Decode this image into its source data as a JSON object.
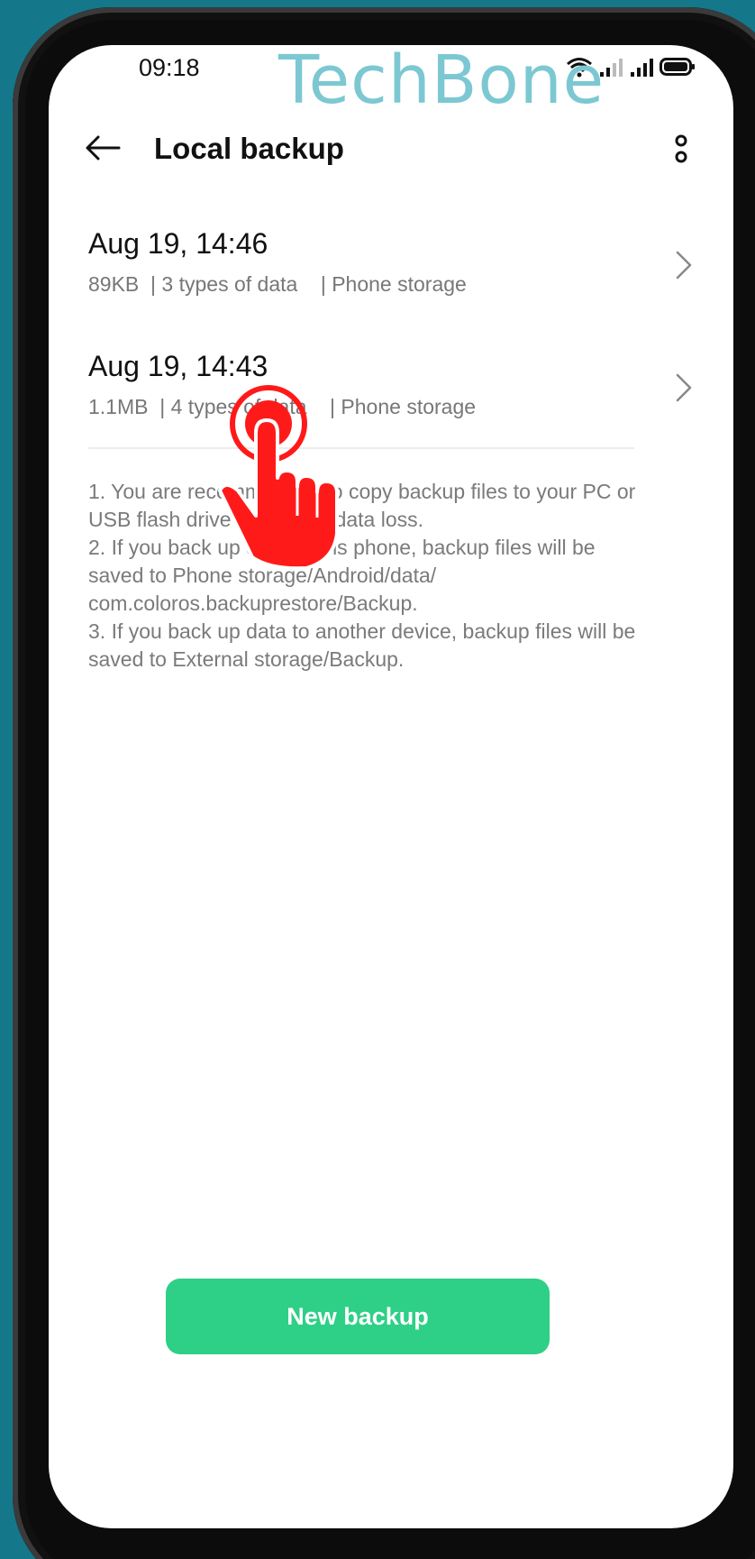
{
  "status_bar": {
    "time": "09:18",
    "icons": [
      "wifi-icon",
      "signal-icon",
      "signal-icon",
      "battery-icon"
    ]
  },
  "watermark": "TechBone",
  "header": {
    "title": "Local backup",
    "back_icon": "arrow-left-icon",
    "more_icon": "more-vertical-icon"
  },
  "backups": [
    {
      "date": "Aug 19, 14:46",
      "meta": "89KB  | 3 types of data    | Phone storage"
    },
    {
      "date": "Aug 19, 14:43",
      "meta": "1.1MB  | 4 types of data    | Phone storage"
    }
  ],
  "notes": [
    "1. You are recommended to copy backup files to your PC or USB flash drive to prevent data loss.",
    "2. If you back up data to this phone, backup files will be saved to Phone storage/Android/data/ com.coloros.backuprestore/Backup.",
    "3. If you back up data to another device, backup files will be saved to External storage/Backup."
  ],
  "footer": {
    "new_backup_label": "New backup"
  },
  "colors": {
    "background": "#14788a",
    "accent": "#2ecf86",
    "watermark": "#7cc8d2",
    "tap_indicator": "#ff1a1a"
  }
}
